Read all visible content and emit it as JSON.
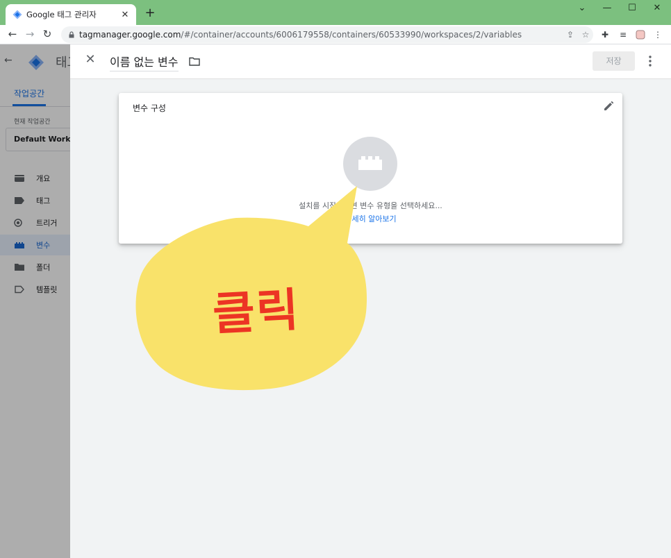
{
  "browser": {
    "tab_title": "Google 태그 관리자",
    "url_host": "tagmanager.google.com",
    "url_path": "/#/container/accounts/6006179558/containers/60533990/workspaces/2/variables"
  },
  "gtm": {
    "app_name": "태그",
    "workspace_tab": "작업공간",
    "current_workspace_label": "현재 작업공간",
    "current_workspace_value": "Default Workspace",
    "nav": [
      {
        "label": "개요",
        "icon": "overview-icon"
      },
      {
        "label": "태그",
        "icon": "tag-icon"
      },
      {
        "label": "트리거",
        "icon": "trigger-icon"
      },
      {
        "label": "변수",
        "icon": "variable-icon",
        "active": true
      },
      {
        "label": "폴더",
        "icon": "folder-icon"
      },
      {
        "label": "템플릿",
        "icon": "template-icon"
      }
    ]
  },
  "editor": {
    "variable_name": "이름 없는 변수",
    "save_label": "저장",
    "card_title": "변수 구성",
    "helper_text": "설치를 시작하려면 변수 유형을 선택하세요...",
    "learn_more": "자세히 알아보기"
  },
  "annotation": {
    "text": "클릭",
    "bubble_color": "#f9e26a",
    "text_color": "#ec3424"
  }
}
